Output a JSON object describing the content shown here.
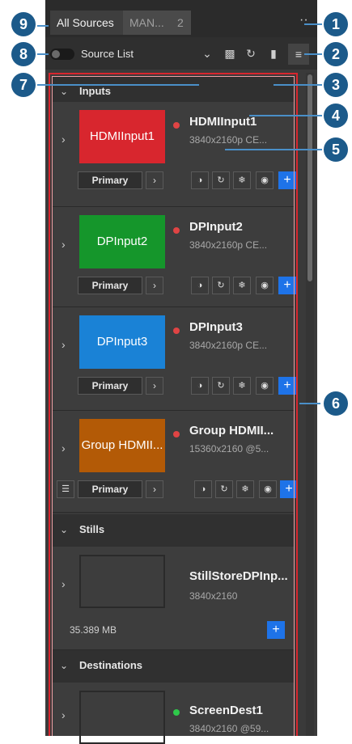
{
  "tabs": {
    "all_sources": "All Sources",
    "man": "MAN...",
    "count": "2",
    "more": "··"
  },
  "toolbar": {
    "source_list_label": "Source List"
  },
  "sections": {
    "inputs": "Inputs",
    "stills": "Stills",
    "destinations": "Destinations"
  },
  "inputs": [
    {
      "thumb": "HDMIInput1",
      "name": "HDMIInput1",
      "res": "3840x2160p CE...",
      "color": "#d8262e",
      "primary": "Primary"
    },
    {
      "thumb": "DPInput2",
      "name": "DPInput2",
      "res": "3840x2160p CE...",
      "color": "#15962b",
      "primary": "Primary"
    },
    {
      "thumb": "DPInput3",
      "name": "DPInput3",
      "res": "3840x2160p CE...",
      "color": "#1a82d6",
      "primary": "Primary"
    },
    {
      "thumb": "Group HDMII...",
      "name": "Group HDMII...",
      "res": "15360x2160 @5...",
      "color": "#b35a06",
      "primary": "Primary"
    }
  ],
  "stills": [
    {
      "name": "StillStoreDPInp...",
      "res": "3840x2160",
      "size": "35.389 MB"
    }
  ],
  "destinations": [
    {
      "name": "ScreenDest1",
      "res": "3840x2160 @59..."
    }
  ],
  "callouts": [
    "1",
    "2",
    "3",
    "4",
    "5",
    "6",
    "7",
    "8",
    "9"
  ],
  "colors": {
    "live_dot": "#e04444",
    "dest_dot": "#2ec94a",
    "accent": "#1e73e8",
    "frame": "#d8262e",
    "callout": "#1c5a8a"
  }
}
